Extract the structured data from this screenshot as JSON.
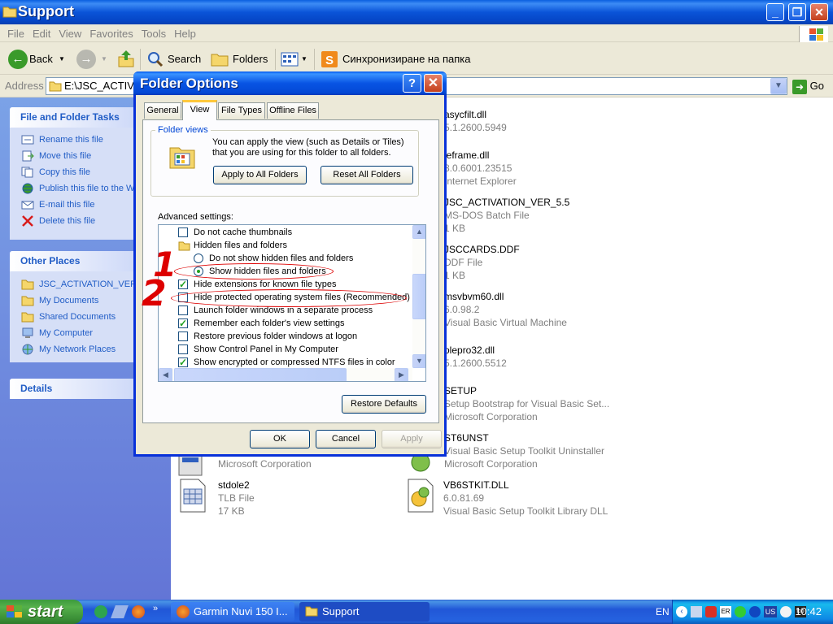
{
  "window": {
    "title": "Support",
    "menu": [
      "File",
      "Edit",
      "View",
      "Favorites",
      "Tools",
      "Help"
    ],
    "toolbar": {
      "back": "Back",
      "search": "Search",
      "folders": "Folders",
      "sync": "Синхронизиране на папка"
    },
    "address": {
      "label": "Address",
      "value": "E:\\JSC_ACTIVATI",
      "go": "Go"
    }
  },
  "taskpane": {
    "tasks": {
      "title": "File and Folder Tasks",
      "items": [
        {
          "label": "Rename this file",
          "icon": "rename-icon"
        },
        {
          "label": "Move this file",
          "icon": "move-icon"
        },
        {
          "label": "Copy this file",
          "icon": "copy-icon"
        },
        {
          "label": "Publish this file to the W",
          "icon": "web-publish-icon"
        },
        {
          "label": "E-mail this file",
          "icon": "email-icon"
        },
        {
          "label": "Delete this file",
          "icon": "delete-icon"
        }
      ]
    },
    "places": {
      "title": "Other Places",
      "items": [
        {
          "label": "JSC_ACTIVATION_VER_",
          "icon": "folder-icon"
        },
        {
          "label": "My Documents",
          "icon": "folder-icon"
        },
        {
          "label": "Shared Documents",
          "icon": "folder-icon"
        },
        {
          "label": "My Computer",
          "icon": "computer-icon"
        },
        {
          "label": "My Network Places",
          "icon": "network-icon"
        }
      ]
    },
    "details": {
      "title": "Details"
    }
  },
  "files": [
    {
      "name": "asycfilt.dll",
      "line2": "5.1.2600.5949",
      "line3": ""
    },
    {
      "name": "ieframe.dll",
      "line2": "8.0.6001.23515",
      "line3": "Internet Explorer"
    },
    {
      "name": "JSC_ACTIVATION_VER_5.5",
      "line2": "MS-DOS Batch File",
      "line3": "1 KB"
    },
    {
      "name": "JSCCARDS.DDF",
      "line2": "DDF File",
      "line3": "1 KB"
    },
    {
      "name": "msvbvm60.dll",
      "line2": "6.0.98.2",
      "line3": "Visual Basic Virtual Machine"
    },
    {
      "name": "olepro32.dll",
      "line2": "5.1.2600.5512",
      "line3": ""
    },
    {
      "name": "SETUP",
      "line2": "Setup Bootstrap for Visual Basic Set...",
      "line3": "Microsoft Corporation"
    },
    {
      "name": "ST6UNST",
      "line2": "Visual Basic Setup Toolkit Uninstaller",
      "line3": "Microsoft Corporation"
    },
    {
      "name": "stdole2",
      "line2": "TLB File",
      "line3": "17 KB"
    },
    {
      "name": "VB6STKIT.DLL",
      "line2": "6.0.81.69",
      "line3": "Visual Basic Setup Toolkit Library DLL"
    },
    {
      "name": "",
      "line2": "",
      "line3": "Microsoft Corporation"
    }
  ],
  "dialog": {
    "title": "Folder Options",
    "tabs": [
      "General",
      "View",
      "File Types",
      "Offline Files"
    ],
    "active_tab": "View",
    "folder_views": {
      "label": "Folder views",
      "text": "You can apply the view (such as Details or Tiles) that you are using for this folder to all folders.",
      "apply_all": "Apply to All Folders",
      "reset_all": "Reset All Folders"
    },
    "advanced_label": "Advanced settings:",
    "settings": [
      {
        "label": "Do not cache thumbnails",
        "kind": "checkbox",
        "checked": false,
        "indent": 1
      },
      {
        "label": "Hidden files and folders",
        "kind": "folder",
        "checked": false,
        "indent": 1
      },
      {
        "label": "Do not show hidden files and folders",
        "kind": "radio",
        "checked": false,
        "indent": 2
      },
      {
        "label": "Show hidden files and folders",
        "kind": "radio",
        "checked": true,
        "indent": 2
      },
      {
        "label": "Hide extensions for known file types",
        "kind": "checkbox",
        "checked": true,
        "indent": 1
      },
      {
        "label": "Hide protected operating system files (Recommended)",
        "kind": "checkbox",
        "checked": false,
        "indent": 1
      },
      {
        "label": "Launch folder windows in a separate process",
        "kind": "checkbox",
        "checked": false,
        "indent": 1
      },
      {
        "label": "Remember each folder's view settings",
        "kind": "checkbox",
        "checked": true,
        "indent": 1
      },
      {
        "label": "Restore previous folder windows at logon",
        "kind": "checkbox",
        "checked": false,
        "indent": 1
      },
      {
        "label": "Show Control Panel in My Computer",
        "kind": "checkbox",
        "checked": false,
        "indent": 1
      },
      {
        "label": "Show encrypted or compressed NTFS files in color",
        "kind": "checkbox",
        "checked": true,
        "indent": 1
      }
    ],
    "restore_defaults": "Restore Defaults",
    "ok": "OK",
    "cancel": "Cancel",
    "apply": "Apply"
  },
  "annotations": {
    "one": "1",
    "two": "2"
  },
  "taskbar": {
    "start": "start",
    "tasks": [
      {
        "label": "Garmin Nuvi 150 I...",
        "icon": "firefox-icon"
      },
      {
        "label": "Support",
        "icon": "folder-icon"
      }
    ],
    "lang": "EN",
    "clock": "10:42"
  },
  "colors": {
    "xp_blue": "#0831d9",
    "link_blue": "#215dc6",
    "annotation_red": "#dd0000",
    "check_green": "#21a121"
  }
}
